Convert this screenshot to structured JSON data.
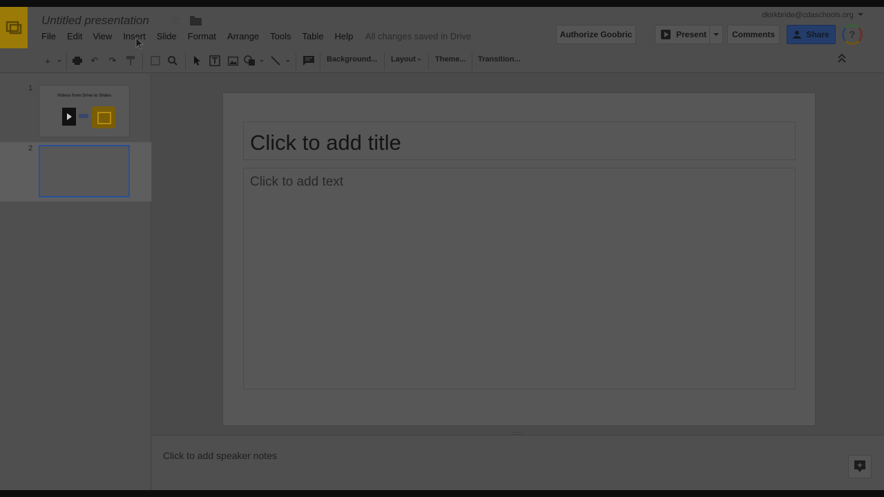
{
  "header": {
    "doc_title": "Untitled presentation",
    "star_icon": "star-icon",
    "folder_icon": "folder-icon",
    "menu": [
      "File",
      "Edit",
      "View",
      "Insert",
      "Slide",
      "Format",
      "Arrange",
      "Tools",
      "Table",
      "Help"
    ],
    "saved_status": "All changes saved in Drive",
    "account": "dkirkbride@cdaschools.org",
    "authorize_label": "Authorize Goobric",
    "present_label": "Present",
    "comments_label": "Comments",
    "share_label": "Share",
    "help_label": "?"
  },
  "toolbar": {
    "background_label": "Background...",
    "layout_label": "Layout",
    "theme_label": "Theme...",
    "transition_label": "Transition..."
  },
  "filmstrip": {
    "slides": [
      {
        "number": "1",
        "title": "Videos from Drive to Slides"
      },
      {
        "number": "2",
        "title": ""
      }
    ]
  },
  "slide": {
    "title_placeholder": "Click to add title",
    "body_placeholder": "Click to add text"
  },
  "notes": {
    "placeholder": "Click to add speaker notes"
  },
  "colors": {
    "brand_yellow": "#9c7a07",
    "share_blue": "#243c69",
    "selection_blue": "#2a4f9a"
  }
}
